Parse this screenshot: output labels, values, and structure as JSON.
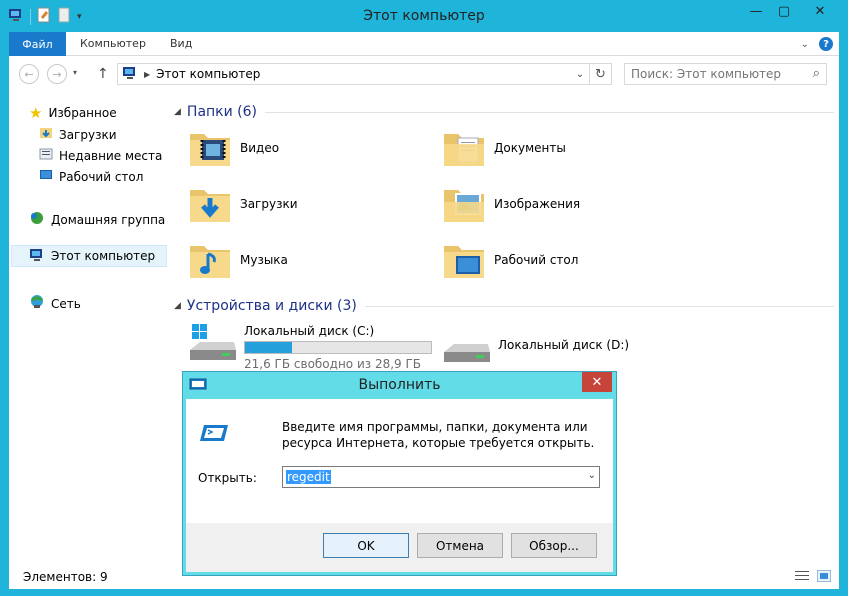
{
  "window": {
    "title": "Этот компьютер"
  },
  "ribbon": {
    "file": "Файл",
    "tabs": [
      "Компьютер",
      "Вид"
    ]
  },
  "nav": {
    "address": "Этот компьютер",
    "search_placeholder": "Поиск: Этот компьютер"
  },
  "sidebar": {
    "favorites": "Избранное",
    "downloads": "Загрузки",
    "recent": "Недавние места",
    "desktop": "Рабочий стол",
    "homegroup": "Домашняя группа",
    "thispc": "Этот компьютер",
    "network": "Сеть"
  },
  "main": {
    "folders_group": "Папки (6)",
    "folders": [
      "Видео",
      "Документы",
      "Загрузки",
      "Изображения",
      "Музыка",
      "Рабочий стол"
    ],
    "devices_group": "Устройства и диски (3)",
    "drive_c": {
      "name": "Локальный диск (C:)",
      "free": "21,6 ГБ свободно из 28,9 ГБ",
      "used_fraction": 0.25
    },
    "drive_d": {
      "name": "Локальный диск (D:)"
    }
  },
  "status": {
    "count": "Элементов: 9"
  },
  "run": {
    "title": "Выполнить",
    "description": "Введите имя программы, папки, документа или ресурса Интернета, которые требуется открыть.",
    "open_label": "Открыть:",
    "value": "regedit",
    "ok": "OK",
    "cancel": "Отмена",
    "browse": "Обзор..."
  },
  "colors": {
    "accent": "#1fb4da",
    "file_tab": "#1979ca",
    "dialog_frame": "#62dde8",
    "close_button": "#c7443a",
    "progress": "#26a0da"
  }
}
